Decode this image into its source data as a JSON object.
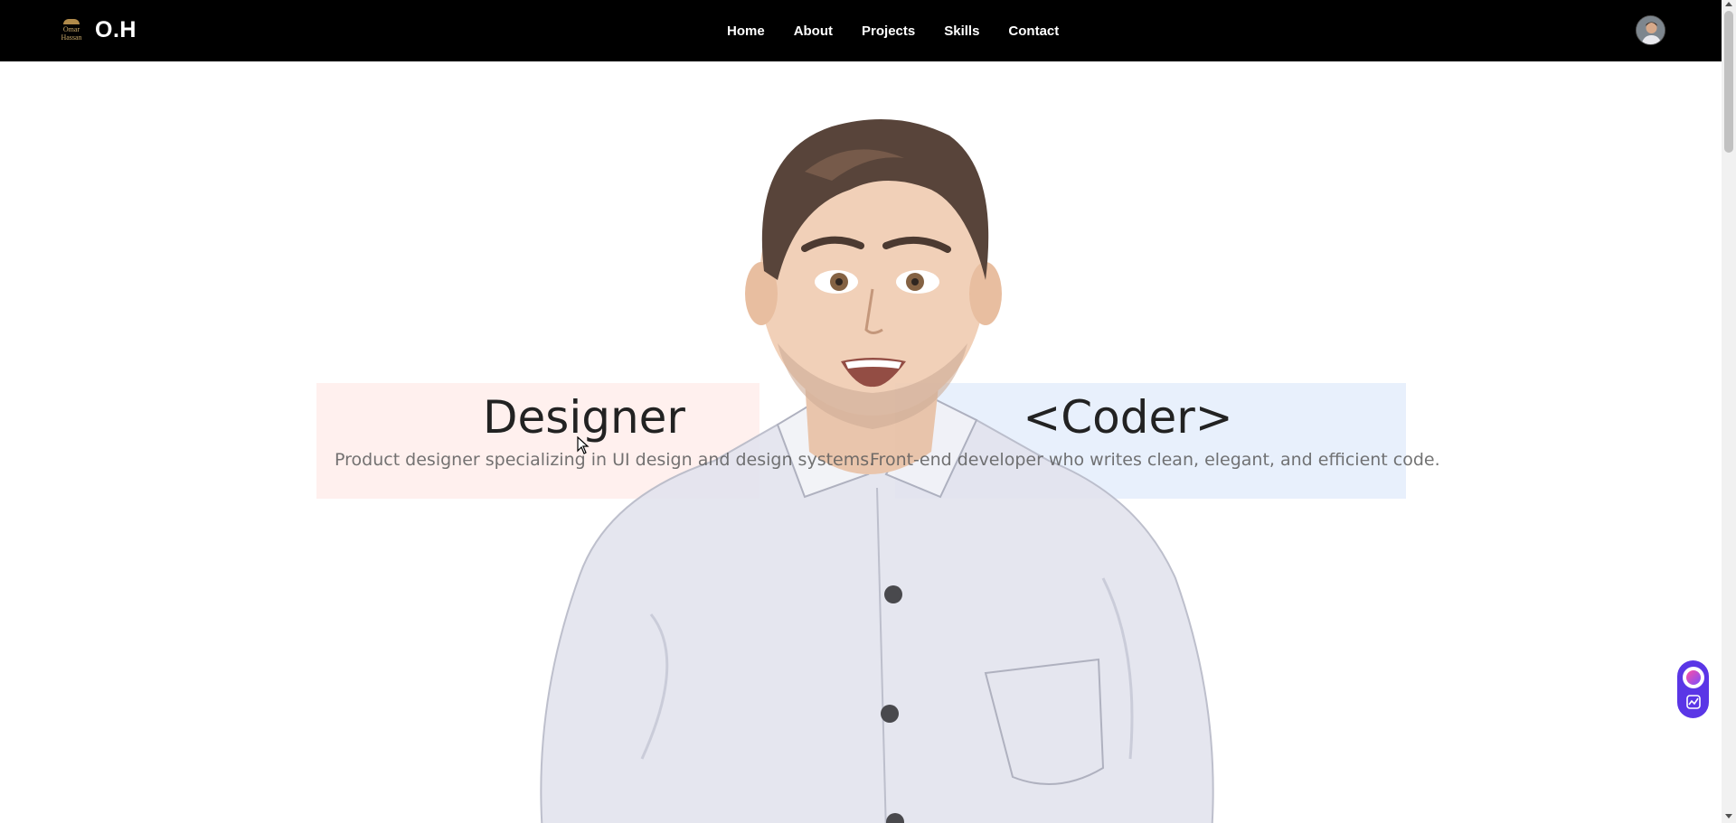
{
  "brand": {
    "logo_text": [
      "Omar",
      "Hassan"
    ],
    "name": "O.H"
  },
  "nav": {
    "items": [
      "Home",
      "About",
      "Projects",
      "Skills",
      "Contact"
    ]
  },
  "hero": {
    "designer": {
      "title": "Designer",
      "description": "Product designer specializing in UI design and design systems."
    },
    "coder": {
      "title": "<Coder>",
      "description": "Front-end developer who writes clean, elegant, and efficient code."
    }
  },
  "icons": {
    "avatar": "user-avatar-icon",
    "widget_top": "assistant-orb-icon",
    "widget_bottom": "chart-edit-icon"
  },
  "colors": {
    "navbar": "#000000",
    "designer_panel": "#fff0ee",
    "coder_panel": "#e8f0fc",
    "widget": "#5a36e6"
  }
}
